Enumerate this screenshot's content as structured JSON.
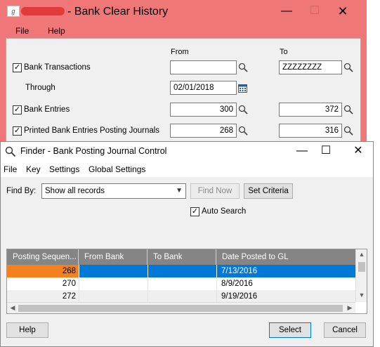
{
  "bg_window": {
    "title": "- Bank Clear History",
    "menu": [
      "File",
      "Help"
    ],
    "col_from": "From",
    "col_to": "To",
    "rows": [
      {
        "label": "Bank Transactions",
        "checked": true,
        "from": "",
        "to": "ZZZZZZZZ"
      },
      {
        "label": "Through",
        "date": "02/01/2018"
      },
      {
        "label": "Bank Entries",
        "checked": true,
        "from": "300",
        "to": "372"
      },
      {
        "label": "Printed Bank Entries Posting Journals",
        "checked": true,
        "from": "268",
        "to": "316"
      }
    ],
    "title_color": "#f07777"
  },
  "finder": {
    "title": "Finder - Bank Posting Journal Control",
    "menu": [
      "File",
      "Key",
      "Settings",
      "Global Settings"
    ],
    "find_by_label": "Find By:",
    "find_by_value": "Show all records",
    "find_now": "Find Now",
    "set_criteria": "Set Criteria",
    "auto_search": "Auto Search",
    "auto_search_checked": true,
    "columns": [
      "Posting Sequen...",
      "From Bank",
      "To Bank",
      "Date Posted to GL"
    ],
    "rows": [
      [
        "268",
        "",
        "",
        "7/13/2016"
      ],
      [
        "270",
        "",
        "",
        "8/9/2016"
      ],
      [
        "272",
        "",
        "",
        "9/19/2016"
      ]
    ],
    "selected_row": 0,
    "buttons": {
      "help": "Help",
      "select": "Select",
      "cancel": "Cancel"
    },
    "accent_color": "#0078d7",
    "highlight_cell_color": "#f7801e"
  }
}
